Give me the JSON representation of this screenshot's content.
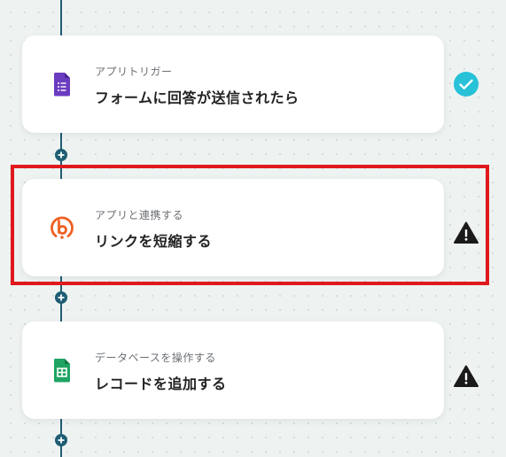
{
  "steps": [
    {
      "category": "アプリトリガー",
      "title": "フォームに回答が送信されたら",
      "icon": "google-forms-icon",
      "status": "completed-check-icon"
    },
    {
      "category": "アプリと連携する",
      "title": "リンクを短縮する",
      "icon": "bitly-icon",
      "status": "warning-icon"
    },
    {
      "category": "データベースを操作する",
      "title": "レコードを追加する",
      "icon": "google-sheets-icon",
      "status": "warning-icon"
    }
  ],
  "colors": {
    "connector": "#1e5d72",
    "check": "#27c1d8",
    "warning": "#1a1a1a",
    "highlight": "#e0191c",
    "forms": "#6a3cc0",
    "bitly": "#ee6123",
    "sheets": "#1fa463"
  }
}
